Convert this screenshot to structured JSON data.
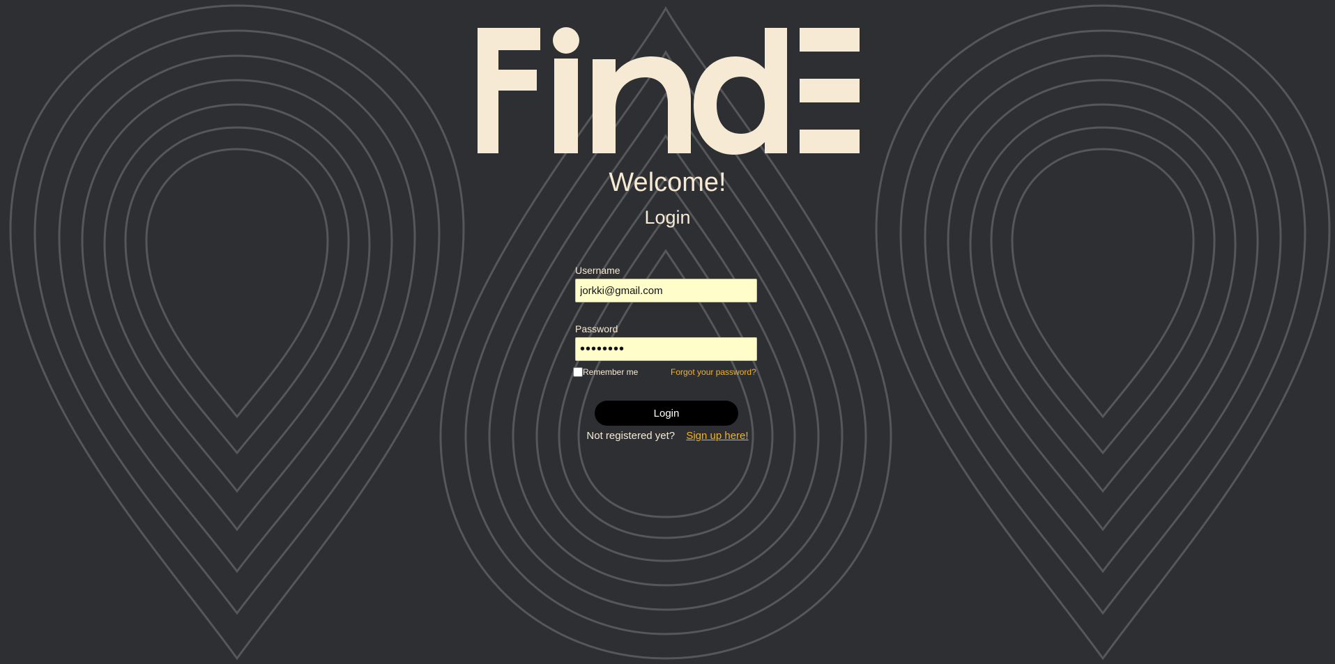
{
  "logo": {
    "text": "FindE",
    "color": "#f7ead4"
  },
  "colors": {
    "background": "#2e2f33",
    "pattern_stroke": "#55575b",
    "text": "#f7ead4",
    "link": "#f4b31f",
    "input_background": "#fffdc9",
    "button_background": "#000000"
  },
  "header": {
    "welcome": "Welcome!",
    "login_heading": "Login"
  },
  "form": {
    "username_label": "Username",
    "username_value": "jorkki@gmail.com",
    "password_label": "Password",
    "password_value": "••••••••",
    "remember_label": "Remember me",
    "remember_checked": false,
    "forgot_link": "Forgot your password?",
    "login_button": "Login",
    "signup_prompt": "Not registered yet?",
    "signup_link": "Sign up here!"
  }
}
